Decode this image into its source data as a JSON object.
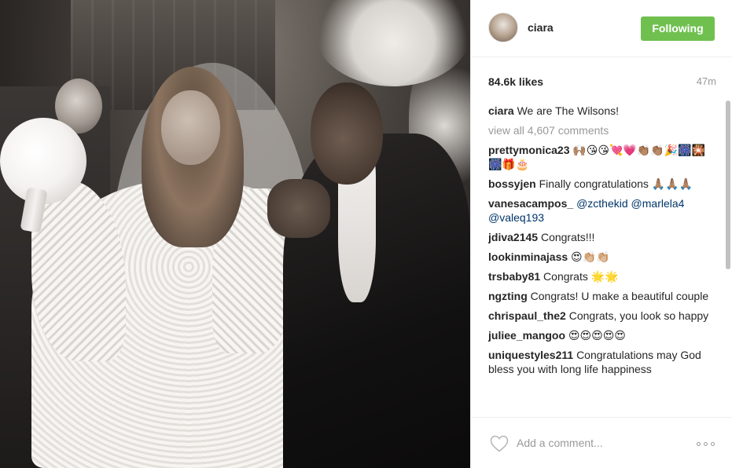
{
  "post": {
    "photo_alt": "photo",
    "author": {
      "username": "ciara",
      "follow_label": "Following"
    },
    "likes": "84.6k likes",
    "time_ago": "47m",
    "caption": {
      "username": "ciara",
      "text": "We are The Wilsons!"
    },
    "view_all_comments": "view all 4,607 comments",
    "comments": [
      {
        "user": "prettymonica23",
        "text": "🙌🏽😘😘💘💗👏🏽👏🏽🎉🎆🎇🎆🎁🎂"
      },
      {
        "user": "bossyjen",
        "text": "Finally congratulations 🙏🏽🙏🏽🙏🏽"
      },
      {
        "user": "vanesacampos_",
        "text": "",
        "mentions": [
          "@zcthekid",
          "@marlela4",
          "@valeq193"
        ]
      },
      {
        "user": "jdiva2145",
        "text": "Congrats!!!"
      },
      {
        "user": "lookinminajass",
        "text": "😍👏🏼👏🏼"
      },
      {
        "user": "trsbaby81",
        "text": "Congrats 🌟🌟"
      },
      {
        "user": "ngzting",
        "text": "Congrats! U make a beautiful couple"
      },
      {
        "user": "chrispaul_the2",
        "text": "Congrats, you look so happy"
      },
      {
        "user": "juliee_mangoo",
        "text": "😍😍😍😍😍"
      },
      {
        "user": "uniquestyles211",
        "text": "Congratulations may God bless you with long life happiness"
      }
    ],
    "add_comment_placeholder": "Add a comment...",
    "icons": {
      "like": "heart-outline-icon",
      "more": "more-options-icon"
    },
    "colors": {
      "follow_button": "#70c050",
      "mention": "#003569",
      "muted": "#999999",
      "text": "#262626"
    }
  }
}
